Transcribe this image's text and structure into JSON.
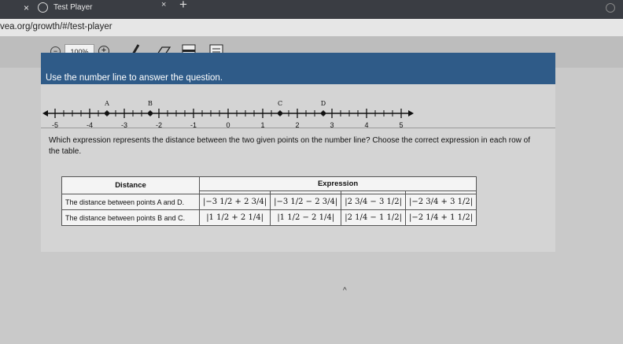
{
  "browser": {
    "tab_close": "×",
    "tab_title": "Test Player",
    "tab_close_2": "×",
    "new_tab": "+",
    "url": "vea.org/growth/#/test-player"
  },
  "toolbar": {
    "zoom_out": "−",
    "zoom_level": "100%",
    "zoom_in": "+"
  },
  "question": {
    "instruction": "Use the number line to answer the question.",
    "prompt_line1": "Which expression represents the distance between the two given points on the number line? Choose the correct expression in each row of",
    "prompt_line2": "the table."
  },
  "number_line": {
    "ticks": [
      "-5",
      "-4",
      "-3",
      "-2",
      "-1",
      "0",
      "1",
      "2",
      "3",
      "4",
      "5"
    ],
    "points": [
      {
        "label": "A",
        "value": -3.5
      },
      {
        "label": "B",
        "value": -2.25
      },
      {
        "label": "C",
        "value": 1.5
      },
      {
        "label": "D",
        "value": 2.75
      }
    ]
  },
  "table": {
    "header_distance": "Distance",
    "header_expression": "Expression",
    "rows": [
      {
        "distance": "The distance between points A and D.",
        "options": [
          "|−3 1/2 + 2 3/4|",
          "|−3 1/2 − 2 3/4|",
          "|2 3/4 − 3 1/2|",
          "|−2 3/4 + 3 1/2|"
        ]
      },
      {
        "distance": "The distance between points B and C.",
        "options": [
          "|1 1/2 + 2 1/4|",
          "|1 1/2 − 2 1/4|",
          "|2 1/4 − 1 1/2|",
          "|−2 1/4 + 1 1/2|"
        ]
      }
    ]
  }
}
